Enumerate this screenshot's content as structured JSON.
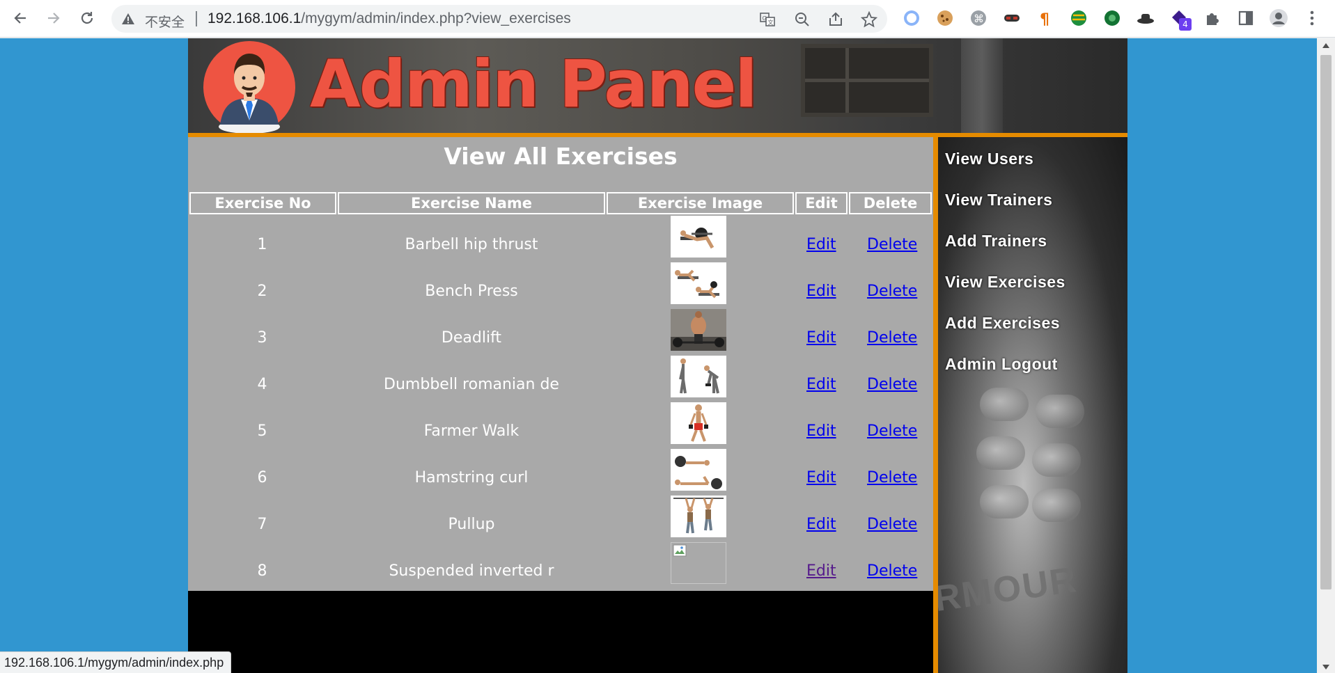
{
  "browser": {
    "security_label": "不安全",
    "url_host": "192.168.106.1",
    "url_path": "/mygym/admin/index.php?view_exercises",
    "extension_badge": "4",
    "status_url": "192.168.106.1/mygym/admin/index.php"
  },
  "header": {
    "title": "Admin Panel"
  },
  "main": {
    "heading": "View All Exercises",
    "columns": [
      "Exercise No",
      "Exercise Name",
      "Exercise Image",
      "Edit",
      "Delete"
    ],
    "rows": [
      {
        "no": "1",
        "name": "Barbell hip thrust",
        "edit": "Edit",
        "delete": "Delete"
      },
      {
        "no": "2",
        "name": "Bench Press",
        "edit": "Edit",
        "delete": "Delete"
      },
      {
        "no": "3",
        "name": "Deadlift",
        "edit": "Edit",
        "delete": "Delete"
      },
      {
        "no": "4",
        "name": "Dumbbell romanian de",
        "edit": "Edit",
        "delete": "Delete"
      },
      {
        "no": "5",
        "name": "Farmer Walk",
        "edit": "Edit",
        "delete": "Delete"
      },
      {
        "no": "6",
        "name": "Hamstring curl",
        "edit": "Edit",
        "delete": "Delete"
      },
      {
        "no": "7",
        "name": "Pullup",
        "edit": "Edit",
        "delete": "Delete"
      },
      {
        "no": "8",
        "name": "Suspended inverted r",
        "edit": "Edit",
        "delete": "Delete"
      }
    ]
  },
  "sidebar": {
    "items": [
      {
        "label": "View Users"
      },
      {
        "label": "View Trainers"
      },
      {
        "label": "Add Trainers"
      },
      {
        "label": "View Exercises"
      },
      {
        "label": "Add Exercises"
      },
      {
        "label": "Admin Logout"
      }
    ],
    "background_brand_text": "RMOUR"
  },
  "colors": {
    "page_background": "#3196d0",
    "accent_orange": "#e58b00",
    "content_gray": "#a9a9a9",
    "title_red": "#ee5442",
    "link_blue": "#0000ee",
    "link_visited": "#551a8b"
  }
}
